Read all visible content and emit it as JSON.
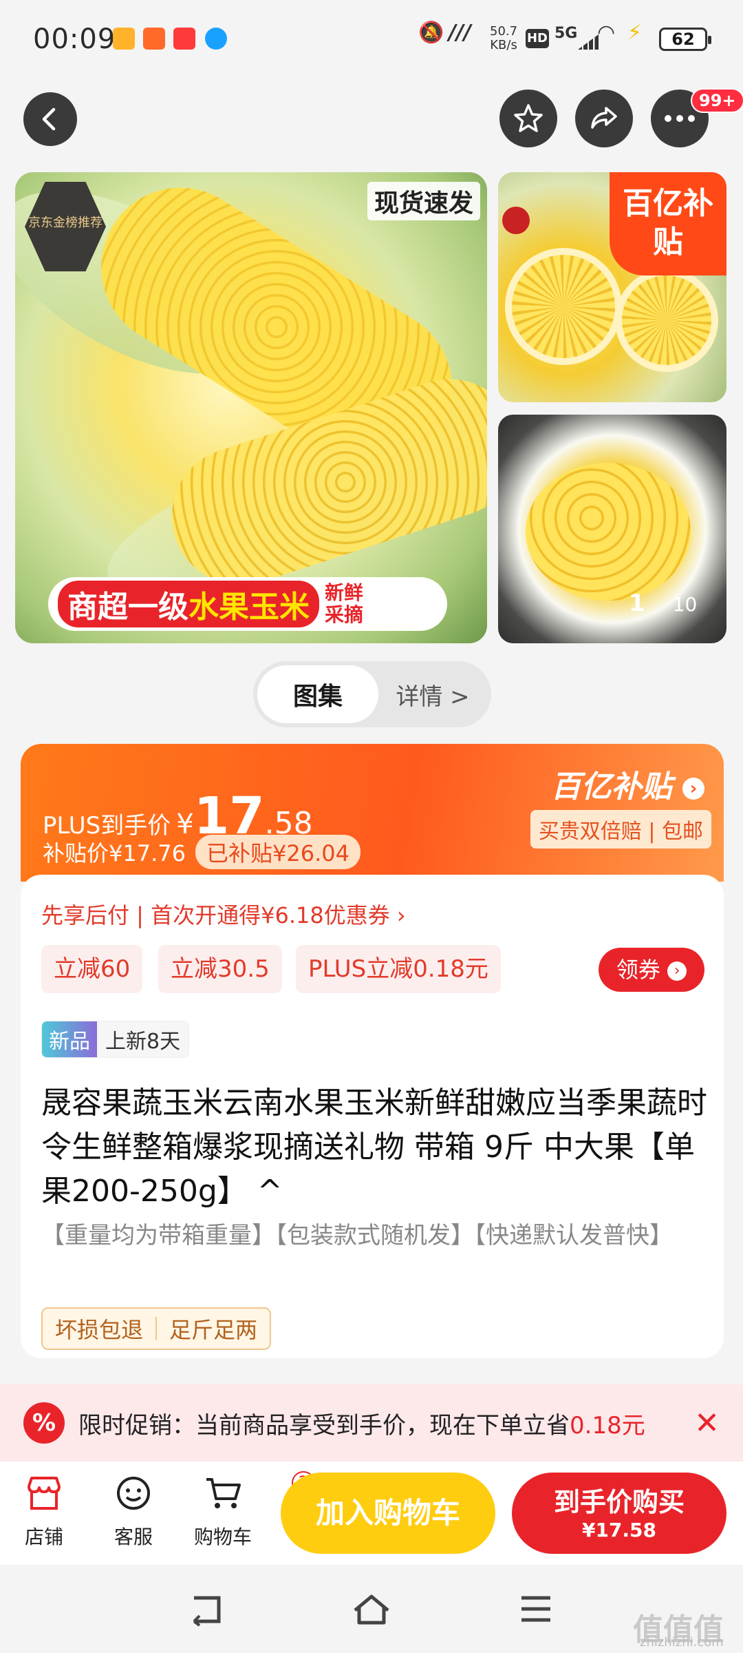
{
  "status_bar": {
    "time": "00:09",
    "net_speed_value": "50.7",
    "net_speed_unit": "KB/s",
    "hd": "HD",
    "signal": "5G",
    "battery": "62"
  },
  "header": {
    "badge": "99+"
  },
  "gallery": {
    "main_badge": "京东金榜推荐",
    "main_tag": "现货速发",
    "banner_main_1": "商超一级",
    "banner_main_2": "水果玉米",
    "banner_side": "新鲜采摘",
    "side_badge": "百亿补贴",
    "page_current": "1",
    "page_total": "10"
  },
  "tabs": {
    "gallery": "图集",
    "details": "详情 >"
  },
  "price": {
    "plus_label": "PLUS到手价",
    "yen": "¥",
    "integer": "17",
    "decimal": ".58",
    "subsidy_price": "补贴价¥17.76",
    "subsidized": "已补贴¥26.04",
    "butie_title": "百亿补贴",
    "butie_sub": "买贵双倍赔 | 包邮"
  },
  "info": {
    "credit_line": "先享后付 | 首次开通得¥6.18优惠券 ›",
    "coupons": [
      "立减60",
      "立减30.5",
      "PLUS立减0.18元"
    ],
    "get_coupon": "领券",
    "new_tag": "新品",
    "new_days": "上新8天",
    "title": "晟容果蔬玉米云南水果玉米新鲜甜嫩应当季果蔬时令生鲜整箱爆浆现摘送礼物 带箱 9斤 中大果【单果200-250g】 ^",
    "desc": "【重量均为带箱重量】【包装款式随机发】【快递默认发普快】",
    "tag1": "坏损包退",
    "tag2": "足斤足两"
  },
  "promo": {
    "icon": "%",
    "text": "限时促销：当前商品享受到手价，现在下单立省",
    "highlight": "0.18元",
    "close": "✕"
  },
  "bottom": {
    "shop": "店铺",
    "service": "客服",
    "cart": "购物车",
    "cart_count": "2",
    "add_cart": "加入购物车",
    "buy_line1": "到手价购买",
    "buy_line2": "¥17.58"
  },
  "watermark": {
    "cn": "值值值",
    "url": "zhizhizhi.com"
  }
}
